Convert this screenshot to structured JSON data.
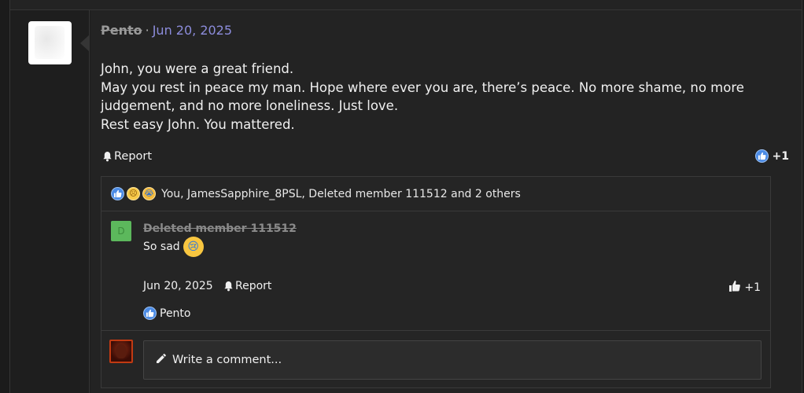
{
  "post": {
    "author": "Pento",
    "separator": "·",
    "date": "Jun 20, 2025",
    "body": [
      "John, you were a great friend.",
      "May you rest in peace my man. Hope where ever you are, there’s peace. No more shame, no more judgement, and no more loneliness. Just love.",
      "Rest easy John. You mattered."
    ],
    "report_label": "Report",
    "reaction_count": "+1"
  },
  "reactions_summary": {
    "icons": [
      "like-icon",
      "sad-icon",
      "cry-icon"
    ],
    "users_text": "You, JamesSapphire_8PSL, Deleted member 111512 and 2 others"
  },
  "comment": {
    "author": "Deleted member 111512",
    "text": "So sad",
    "date": "Jun 20, 2025",
    "report_label": "Report",
    "like_count": "+1",
    "reactor": "Pento"
  },
  "write_comment": {
    "placeholder": "Write a comment..."
  },
  "colors": {
    "accent_link": "#8c8cdb",
    "like_blue": "#4b8be5",
    "background": "#1b1b1b",
    "panel": "#232323"
  }
}
